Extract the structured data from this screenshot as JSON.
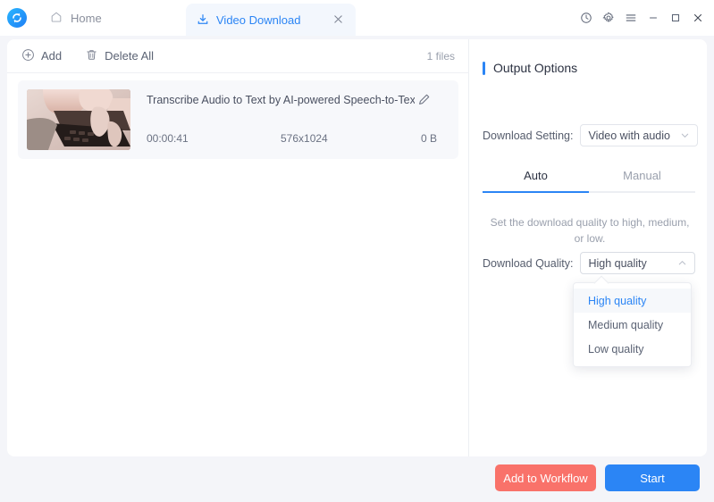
{
  "app": {
    "logo_icon": "app-logo-icon",
    "accent_color": "#2b85f5"
  },
  "titlebar": {
    "home_tab": {
      "label": "Home",
      "icon": "home-icon"
    },
    "document_tab": {
      "label": "Video Download",
      "icon": "download-icon",
      "close_icon": "close-icon"
    },
    "window_controls": [
      {
        "name": "history-icon",
        "glyph": "history"
      },
      {
        "name": "settings-gear-icon",
        "glyph": "gear"
      },
      {
        "name": "menu-icon",
        "glyph": "hamburger"
      },
      {
        "name": "minimize-icon",
        "glyph": "minimize"
      },
      {
        "name": "maximize-icon",
        "glyph": "maximize"
      },
      {
        "name": "close-window-icon",
        "glyph": "close"
      }
    ]
  },
  "toolbar": {
    "add_label": "Add",
    "add_icon": "plus-circle-icon",
    "delete_all_label": "Delete All",
    "delete_all_icon": "trash-icon",
    "file_count": "1 files"
  },
  "file_list": {
    "items": [
      {
        "title": "Transcribe Audio to Text by AI-powered Speech-to-Text Conv...",
        "duration": "00:00:41",
        "resolution": "576x1024",
        "size": "0 B",
        "edit_icon": "pencil-edit-icon",
        "thumbnail": "laptop-typing-thumbnail"
      }
    ]
  },
  "output_options": {
    "title": "Output Options",
    "download_setting": {
      "label": "Download Setting:",
      "value": "Video with audio",
      "caret_icon": "chevron-down-icon"
    },
    "tabs": [
      {
        "label": "Auto",
        "active": true
      },
      {
        "label": "Manual",
        "active": false
      }
    ],
    "description": "Set the download quality to high, medium, or low.",
    "download_quality": {
      "label": "Download Quality:",
      "value": "High quality",
      "caret_icon": "chevron-up-icon",
      "options": [
        {
          "label": "High quality",
          "selected": true
        },
        {
          "label": "Medium quality",
          "selected": false
        },
        {
          "label": "Low quality",
          "selected": false
        }
      ]
    }
  },
  "footer": {
    "add_to_workflow_label": "Add to Workflow",
    "add_to_workflow_color": "#f9726a",
    "start_label": "Start",
    "start_color": "#2b85f5"
  }
}
